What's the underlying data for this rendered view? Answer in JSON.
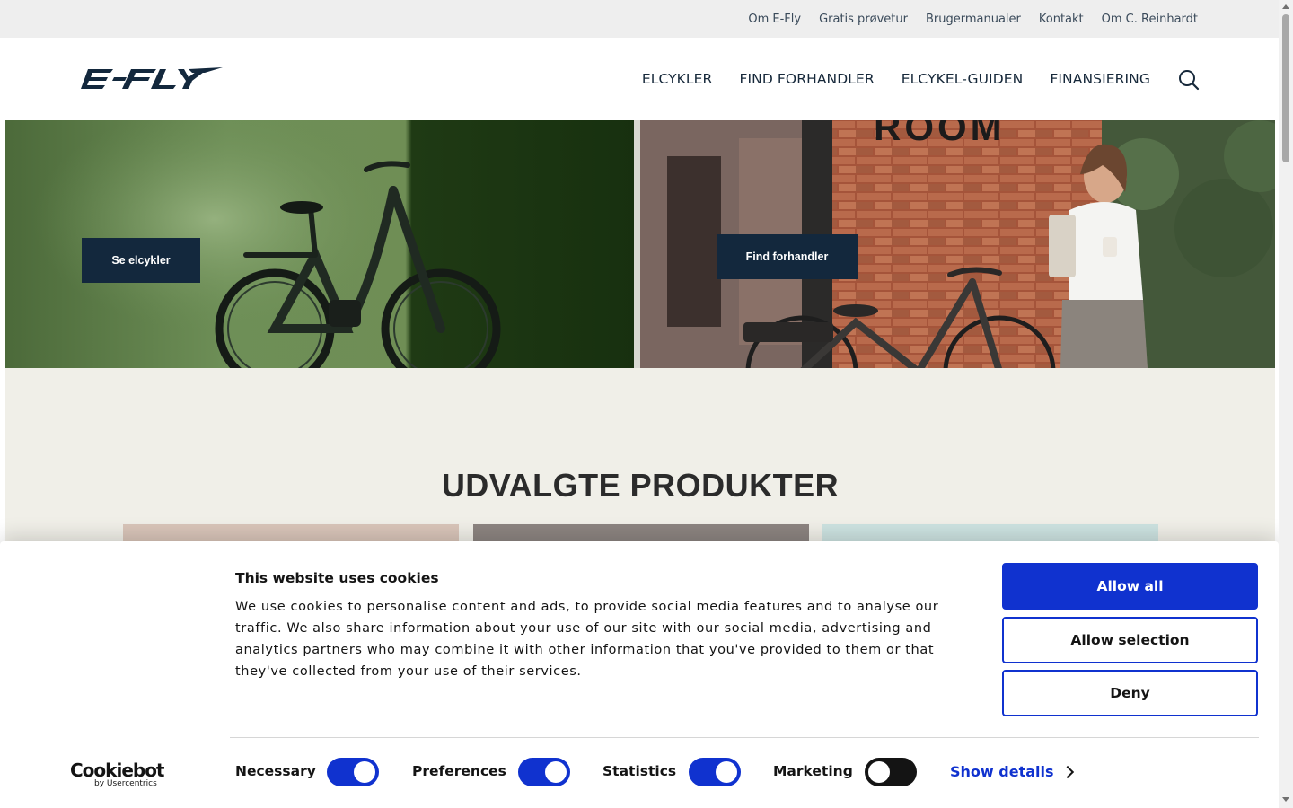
{
  "topbar": {
    "links": [
      "Om E-Fly",
      "Gratis prøvetur",
      "Brugermanualer",
      "Kontakt",
      "Om C. Reinhardt"
    ]
  },
  "header": {
    "logo_text": "E-FLY",
    "nav": [
      "ELCYKLER",
      "FIND FORHANDLER",
      "ELCYKEL-GUIDEN",
      "FINANSIERING"
    ],
    "search_icon": "search-icon"
  },
  "hero": {
    "left_button": "Se elcykler",
    "right_button": "Find forhandler",
    "right_sign_text": "ROOM"
  },
  "section": {
    "title_bold": "UDVALGTE",
    "title_rest": "PRODUKTER"
  },
  "cookie_banner": {
    "title": "This website uses cookies",
    "text": "We use cookies to personalise content and ads, to provide social media features and to analyse our traffic. We also share information about your use of our site with our social media, advertising and analytics partners who may combine it with other information that you've provided to them or that they've collected from your use of their services.",
    "buttons": {
      "allow_all": "Allow all",
      "allow_selection": "Allow selection",
      "deny": "Deny"
    },
    "consents": [
      {
        "label": "Necessary",
        "on": true
      },
      {
        "label": "Preferences",
        "on": true
      },
      {
        "label": "Statistics",
        "on": true
      },
      {
        "label": "Marketing",
        "on": false
      }
    ],
    "show_details": "Show details",
    "brand_main": "Cookiebot",
    "brand_sub": "by Usercentrics"
  },
  "colors": {
    "navy": "#13283d",
    "cookiebot_blue": "#1032cf",
    "section_bg": "#f0efe8",
    "topbar_bg": "#eeeeee"
  }
}
